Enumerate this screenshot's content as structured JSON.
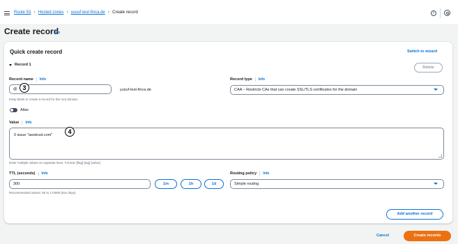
{
  "breadcrumbs": [
    "Route 53",
    "Hosted zones",
    "yusuf-test-finca.de"
  ],
  "breadcrumb_current": "Create record",
  "top_info_glyph": "i",
  "page": {
    "title": "Create record",
    "info": "Info"
  },
  "panel": {
    "title": "Quick create record",
    "switch_link": "Switch to wizard"
  },
  "record": {
    "toggle_label": "Record 1",
    "delete_label": "Delete"
  },
  "record_name": {
    "label": "Record name",
    "info": "Info",
    "value": "@",
    "domain_suffix": "yusuf-test-finca.de",
    "hint": "Keep blank to create a record for the root domain."
  },
  "record_type": {
    "label": "Record type",
    "info": "Info",
    "selected": "CAA – Restricts CAs that can create SSL/TLS certificates for the domain"
  },
  "alias": {
    "label": "Alias",
    "enabled": false
  },
  "value_field": {
    "label": "Value",
    "info": "Info",
    "value": "0 issue \"awstrust.com\"",
    "hint": "Enter multiple values on separate lines. Format: [flag] [tag] [value]"
  },
  "ttl": {
    "label": "TTL (seconds)",
    "info": "Info",
    "value": "300",
    "hint": "Recommended values: 60 to 172800 (two days)",
    "buttons": [
      "1m",
      "1h",
      "1d"
    ]
  },
  "routing": {
    "label": "Routing policy",
    "info": "Info",
    "selected": "Simple routing"
  },
  "actions": {
    "add_another": "Add another record",
    "cancel": "Cancel",
    "create": "Create records"
  },
  "annotations": [
    "3",
    "4"
  ],
  "colors": {
    "accent": "#0972d3",
    "primary_button": "#ec7211",
    "text": "#16191f"
  },
  "icons": [
    "menu-icon",
    "chevron-right-icon",
    "info-icon",
    "settings-icon",
    "caret-down-icon"
  ]
}
